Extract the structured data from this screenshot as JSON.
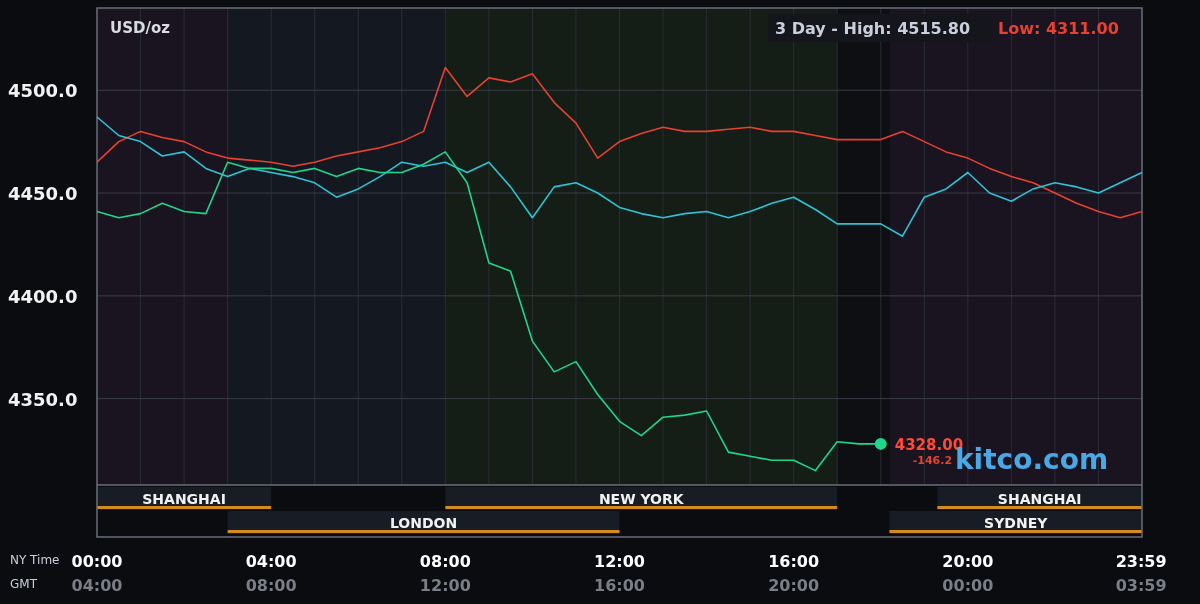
{
  "chart": {
    "unit": "USD/oz",
    "range_label": "3 Day - High: 4515.80",
    "low_label": "Low: 4311.00",
    "chart_data": {
      "type": "line",
      "ylim": [
        4308,
        4540
      ],
      "xlim": [
        0,
        24
      ],
      "grid": true,
      "x": [
        0,
        0.5,
        1,
        1.5,
        2,
        2.5,
        3,
        3.5,
        4,
        4.5,
        5,
        5.5,
        6,
        6.5,
        7,
        7.5,
        8,
        8.5,
        9,
        9.5,
        10,
        10.5,
        11,
        11.5,
        12,
        12.5,
        13,
        13.5,
        14,
        14.5,
        15,
        15.5,
        16,
        16.5,
        17,
        17.5,
        18,
        18.5,
        19,
        19.5,
        20,
        20.5,
        21,
        21.5,
        22,
        22.5,
        23,
        23.5,
        24
      ],
      "yticks": [
        {
          "value": 4350,
          "label": "4350.0"
        },
        {
          "value": 4400,
          "label": "4400.0"
        },
        {
          "value": 4450,
          "label": "4450.0"
        },
        {
          "value": 4500,
          "label": "4500.0"
        }
      ],
      "xticks": [
        {
          "value": 0,
          "label": "00:00"
        },
        {
          "value": 4,
          "label": "04:00"
        },
        {
          "value": 8,
          "label": "08:00"
        },
        {
          "value": 12,
          "label": "12:00"
        },
        {
          "value": 16,
          "label": "16:00"
        },
        {
          "value": 20,
          "label": "20:00"
        },
        {
          "value": 23.98,
          "label": "23:59"
        }
      ],
      "series": [
        {
          "color": "#e8412f",
          "values": [
            4465,
            4475,
            4480,
            4477,
            4475,
            4470,
            4467,
            4466,
            4465,
            4463,
            4465,
            4468,
            4470,
            4472,
            4475,
            4480,
            4511,
            4497,
            4506,
            4504,
            4508,
            4494,
            4484,
            4467,
            4475,
            4479,
            4482,
            4480,
            4480,
            4481,
            4482,
            4480,
            4480,
            4478,
            4476,
            4476,
            4476,
            4480,
            4475,
            4470,
            4467,
            4462,
            4458,
            4455,
            4450,
            4445,
            4441,
            4438,
            4441
          ]
        },
        {
          "color": "#2ec4d6",
          "values": [
            4487,
            4478,
            4475,
            4468,
            4470,
            4462,
            4458,
            4462,
            4460,
            4458,
            4455,
            4448,
            4452,
            4458,
            4465,
            4463,
            4465,
            4460,
            4465,
            4453,
            4438,
            4453,
            4455,
            4450,
            4443,
            4440,
            4438,
            4440,
            4441,
            4438,
            4441,
            4445,
            4448,
            4442,
            4435,
            4435,
            4435,
            4429,
            4448,
            4452,
            4460,
            4450,
            4446,
            4452,
            4455,
            4453,
            4450,
            4455,
            4460
          ]
        },
        {
          "color": "#1fd68a",
          "values": [
            4441,
            4438,
            4440,
            4445,
            4441,
            4440,
            4465,
            4462,
            4462,
            4460,
            4462,
            4458,
            4462,
            4460,
            4460,
            4464,
            4470,
            4455,
            4416,
            4412,
            4378,
            4363,
            4368,
            4352,
            4339,
            4332,
            4341,
            4342,
            4344,
            4324,
            4322,
            4320,
            4320,
            4315,
            4329,
            4328,
            4328,
            null,
            null,
            null,
            null,
            null,
            null,
            null,
            null,
            null,
            null,
            null,
            null
          ]
        }
      ]
    },
    "last_price": "4328.00",
    "change": "-146.2",
    "brand": "kitco.com",
    "session_rows": [
      [
        {
          "label": "SHANGHAI"
        },
        {
          "label": "NEW YORK"
        },
        {
          "label": "SHANGHAI"
        }
      ],
      [
        {
          "label": "LONDON"
        },
        {
          "label": "SYDNEY"
        }
      ]
    ],
    "ny_time_label": "NY Time",
    "gmt_label": "GMT",
    "gmt_ticks": [
      "04:00",
      "08:00",
      "12:00",
      "16:00",
      "20:00",
      "00:00",
      "03:59"
    ]
  }
}
